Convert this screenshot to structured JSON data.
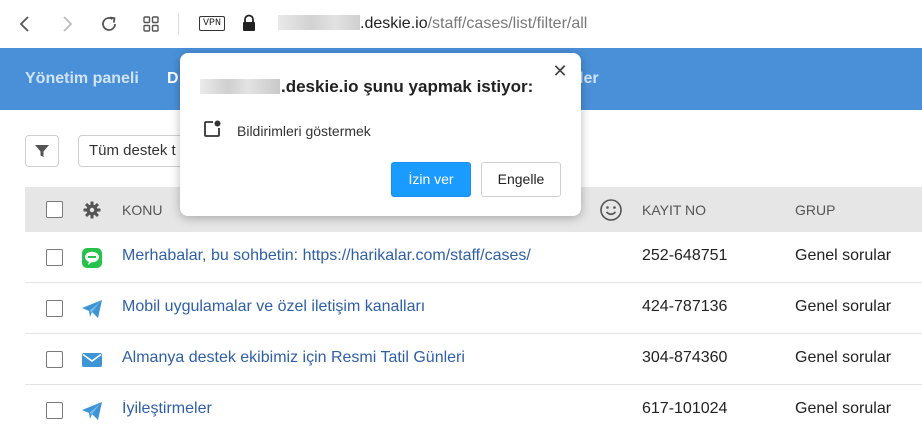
{
  "browser": {
    "vpn_label": "VPN",
    "url_host": ".deskie.io",
    "url_path": "/staff/cases/list/filter/all"
  },
  "nav": {
    "items": [
      {
        "label": "Yönetim paneli",
        "active": false
      },
      {
        "label": "D",
        "active": true
      },
      {
        "label": "ler",
        "active": false
      }
    ]
  },
  "filter": {
    "select_value": "Tüm destek t"
  },
  "table": {
    "columns": {
      "subject": "KONU",
      "ticket_no": "KAYIT NO",
      "group": "GRUP"
    },
    "rows": [
      {
        "channel_icon": "chat-bubble-icon",
        "subject": "Merhabalar, bu sohbetin: https://harikalar.com/staff/cases/",
        "ticket_no": "252-648751",
        "group": "Genel sorular"
      },
      {
        "channel_icon": "paper-plane-icon",
        "subject": "Mobil uygulamalar ve özel iletişim kanalları",
        "ticket_no": "424-787136",
        "group": "Genel sorular"
      },
      {
        "channel_icon": "envelope-icon",
        "subject": "Almanya destek ekibimiz için Resmi Tatil Günleri",
        "ticket_no": "304-874360",
        "group": "Genel sorular"
      },
      {
        "channel_icon": "paper-plane-icon",
        "subject": "İyileştirmeler",
        "ticket_no": "617-101024",
        "group": "Genel sorular"
      }
    ]
  },
  "popup": {
    "close_glyph": "✕",
    "title_suffix": ".deskie.io şunu yapmak istiyor:",
    "permission_text": "Bildirimleri göstermek",
    "allow_label": "İzin ver",
    "block_label": "Engelle"
  },
  "colors": {
    "nav_bg": "#4a90d9",
    "link": "#2f5fa8",
    "allow_button": "#1a9bff",
    "chat_icon": "#27c24c",
    "telegram_icon": "#3d95d6"
  }
}
